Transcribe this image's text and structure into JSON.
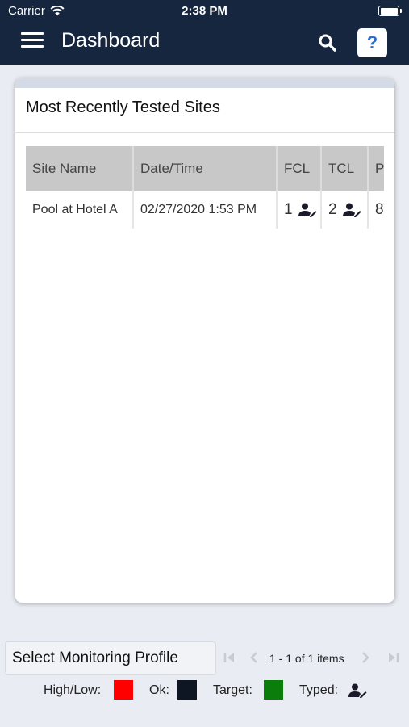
{
  "status_bar": {
    "carrier": "Carrier",
    "time": "2:38 PM"
  },
  "header": {
    "title": "Dashboard",
    "menu_icon": "hamburger-menu-icon",
    "search_icon": "search-icon",
    "help_label": "?"
  },
  "card": {
    "title": "Most Recently Tested Sites",
    "table": {
      "columns": [
        "Site Name",
        "Date/Time",
        "FCL",
        "TCL",
        "P"
      ],
      "rows": [
        {
          "site": "Pool at Hotel A",
          "datetime": "02/27/2020 1:53 PM",
          "fcl": "1",
          "tcl": "2",
          "p": "8"
        }
      ]
    }
  },
  "footer": {
    "select_profile_label": "Select Monitoring Profile",
    "pager_text": "1 - 1 of 1 items",
    "legend": {
      "high_low_label": "High/Low:",
      "ok_label": "Ok:",
      "target_label": "Target:",
      "typed_label": "Typed:"
    },
    "colors": {
      "high_low": "#ff0000",
      "ok": "#0d1622",
      "target": "#0a7d0a",
      "header_bg": "#16263f"
    }
  }
}
